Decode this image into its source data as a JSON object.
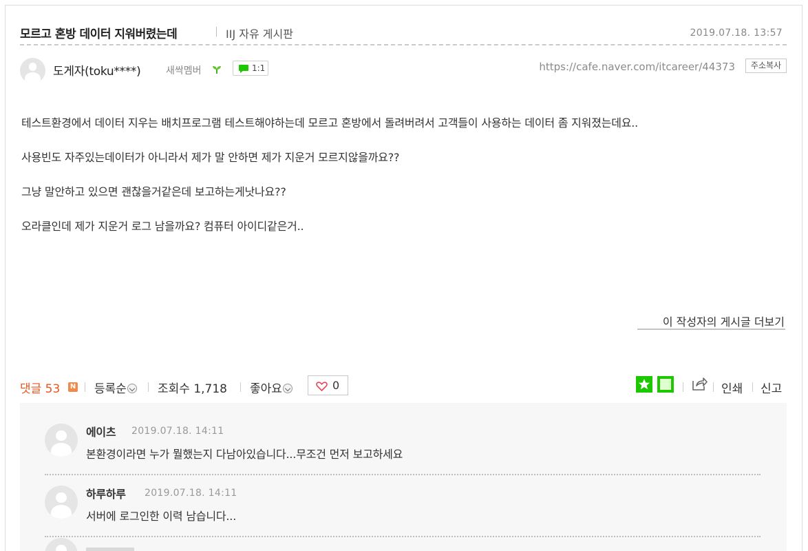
{
  "post": {
    "title": "모르고 혼방 데이터 지워버렸는데",
    "board": "IIJ 자유 게시판",
    "date": "2019.07.18. 13:57",
    "author": {
      "nickname": "도게자(toku****)",
      "grade": "새싹멤버",
      "chat_label": "1:1"
    },
    "url": "https://cafe.naver.com/itcareer/44373",
    "copy_label": "주소복사",
    "paragraphs": [
      "테스트환경에서 데이터 지우는 배치프로그램 테스트해야하는데 모르고 혼방에서 돌려버려서 고객들이 사용하는 데이터 좀 지워졌는데요..",
      "사용빈도 자주있는데이터가 아니라서 제가 말 안하면 제가 지운거 모르지않을까요??",
      "그냥 말안하고 있으면 괜찮을거같은데 보고하는게낫나요??",
      "오라클인데 제가 지운거 로그 남을까요? 컴퓨터 아이디같은거.."
    ],
    "more_label": "이 작성자의 게시글 더보기"
  },
  "stats": {
    "comment_label": "댓글 53",
    "new_badge": "N",
    "sort_label": "등록순",
    "views_label": "조회수 1,718",
    "likes_label": "좋아요",
    "like_count": "0",
    "print_label": "인쇄",
    "report_label": "신고"
  },
  "comments": [
    {
      "nickname": "에이츠",
      "date": "2019.07.18. 14:11",
      "text": "본환경이라면 누가 뭘했는지 다남아있습니다...무조건 먼저 보고하세요"
    },
    {
      "nickname": "하루하루",
      "date": "2019.07.18. 14:11",
      "text": "서버에 로그인한 이력 남습니다..."
    }
  ],
  "colors": {
    "accent_orange": "#e8561c",
    "naver_green": "#1ec800",
    "heart_red": "#e8475a"
  },
  "icons": [
    "sprout-icon",
    "chat-bubble-icon",
    "chevron-down-icon",
    "heart-icon",
    "star-icon",
    "square-icon",
    "share-icon"
  ]
}
